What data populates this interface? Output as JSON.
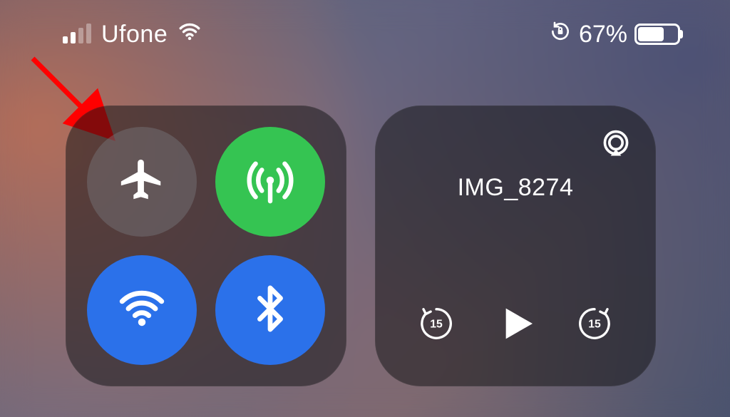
{
  "status": {
    "carrier": "Ufone",
    "signal_bars_active": 2,
    "signal_bars_total": 4,
    "battery_percent_label": "67%",
    "battery_percent_value": 67
  },
  "connectivity": {
    "airplane": {
      "enabled": false,
      "icon": "airplane-icon"
    },
    "cellular": {
      "enabled": true,
      "icon": "cellular-antenna-icon"
    },
    "wifi": {
      "enabled": true,
      "icon": "wifi-icon"
    },
    "bluetooth": {
      "enabled": true,
      "icon": "bluetooth-icon"
    }
  },
  "media": {
    "now_playing_title": "IMG_8274",
    "skip_back_seconds": "15",
    "skip_forward_seconds": "15"
  },
  "annotation": {
    "arrow_color": "#ff0000"
  },
  "colors": {
    "toggle_green": "#35c452",
    "toggle_blue": "#2b71ea",
    "toggle_off": "rgba(120,120,125,0.45)"
  }
}
